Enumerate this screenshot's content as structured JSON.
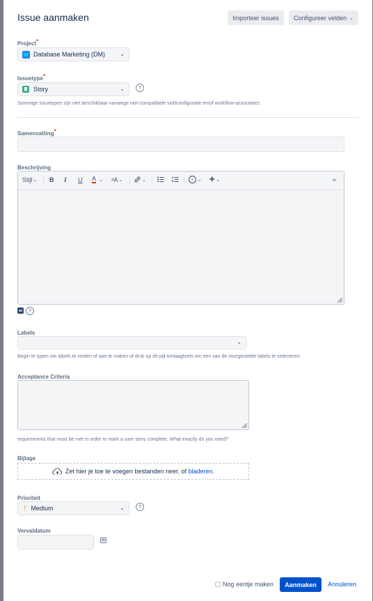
{
  "header": {
    "title": "Issue aanmaken",
    "import_label": "Importeer issues",
    "configure_label": "Configureer velden"
  },
  "project": {
    "label": "Project",
    "required_mark": "*",
    "value": "Database Marketing (DM)"
  },
  "issuetype": {
    "label": "Issuetype",
    "required_mark": "*",
    "value": "Story",
    "note": "Sommige issuetypes zijn niet beschikbaar vanwege niet-compatibele veldconfiguratie en/of workflow-associaties."
  },
  "summary": {
    "label": "Samenvatting",
    "required_mark": "*",
    "value": ""
  },
  "description": {
    "label": "Beschrijving",
    "toolbar": {
      "style_label": "Stijl",
      "bold": "B",
      "italic": "I",
      "underline": "U",
      "text_color": "A",
      "more_format": "ᵃA",
      "link": "🔗",
      "bullet_list": "☰",
      "numbered_list": "☷",
      "emoji": "☺",
      "insert": "✚",
      "collapse": "≈"
    },
    "value": ""
  },
  "labels": {
    "label": "Labels",
    "value": "",
    "note": "Begin te typen om labels te vinden of aan te maken of druk op de pijl-omlaagtoets om een van de voorgestelde labels te selecteren."
  },
  "acceptance": {
    "label": "Acceptance Criteria",
    "value": "",
    "note": "requirements that must be met in order to mark a user story complete. What exactly do you need?"
  },
  "attachment": {
    "label": "Bijlage",
    "drop_text": "Zet hier je toe te voegen bestanden neer, of ",
    "browse_link": "bladeren",
    "drop_suffix": "."
  },
  "priority": {
    "label": "Prioriteit",
    "value": "Medium"
  },
  "duedate": {
    "label": "Vervaldatum",
    "value": ""
  },
  "footer": {
    "create_another_label": "Nog eentje maken",
    "create_button": "Aanmaken",
    "cancel_link": "Annuleren"
  },
  "colors": {
    "primary": "#0052cc",
    "required": "#de350b",
    "priority_medium": "#ff8b00",
    "story": "#36b37e"
  }
}
